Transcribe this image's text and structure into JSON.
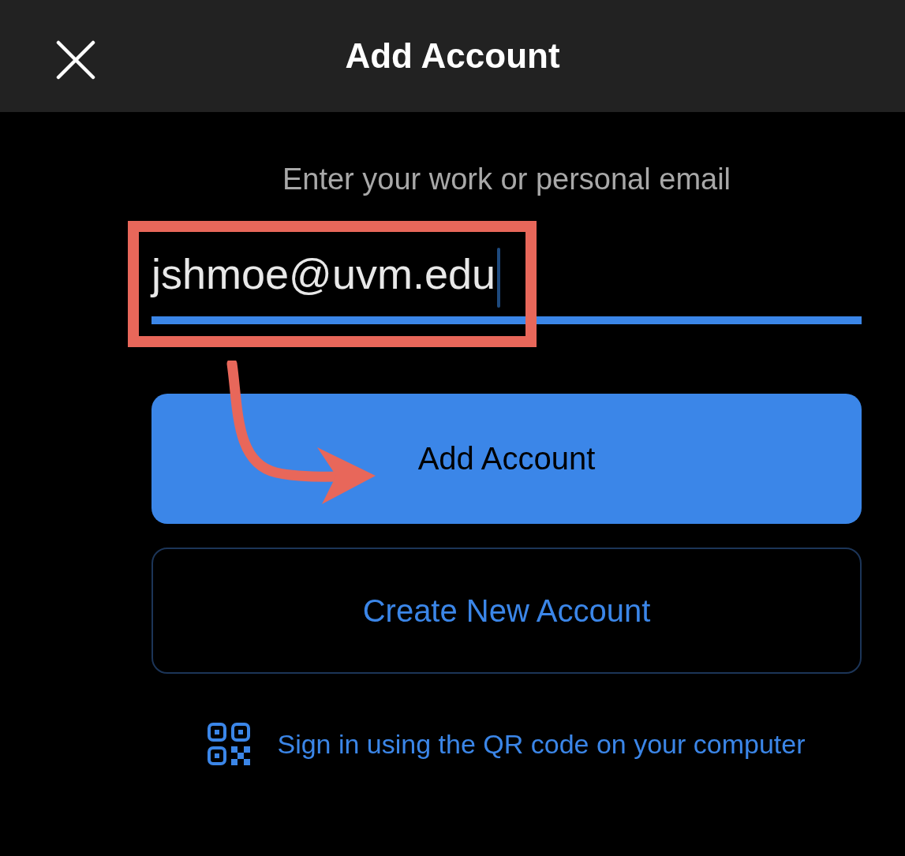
{
  "header": {
    "title": "Add Account"
  },
  "email": {
    "label": "Enter your work or personal email",
    "value": "jshmoe@uvm.edu"
  },
  "buttons": [
    {
      "label": "Add Account",
      "kind": "primary"
    },
    {
      "label": "Create New Account",
      "kind": "outline"
    }
  ],
  "qr_link": {
    "label": "Sign in using the QR code on your computer"
  }
}
